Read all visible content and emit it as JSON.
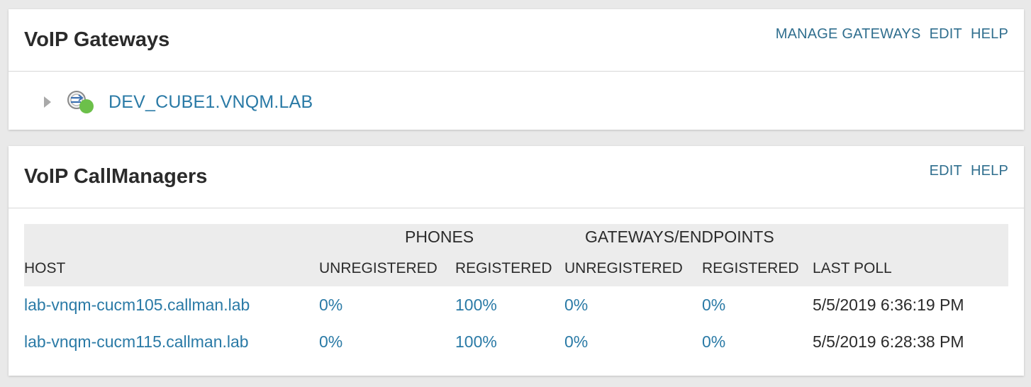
{
  "gateways_panel": {
    "title": "VoIP Gateways",
    "actions": [
      "MANAGE GATEWAYS",
      "EDIT",
      "HELP"
    ],
    "items": [
      {
        "name": "DEV_CUBE1.VNQM.LAB",
        "status": "up",
        "status_color": "#6cc04a"
      }
    ]
  },
  "callmanagers_panel": {
    "title": "VoIP CallManagers",
    "actions": [
      "EDIT",
      "HELP"
    ],
    "table": {
      "groups": {
        "phones": "PHONES",
        "gateways_endpoints": "GATEWAYS/ENDPOINTS"
      },
      "columns": [
        "HOST",
        "UNREGISTERED",
        "REGISTERED",
        "UNREGISTERED",
        "REGISTERED",
        "LAST POLL"
      ],
      "rows": [
        {
          "host": "lab-vnqm-cucm105.callman.lab",
          "phones_unregistered": "0%",
          "phones_registered": "100%",
          "gw_unregistered": "0%",
          "gw_registered": "0%",
          "last_poll": "5/5/2019 6:36:19 PM"
        },
        {
          "host": "lab-vnqm-cucm115.callman.lab",
          "phones_unregistered": "0%",
          "phones_registered": "100%",
          "gw_unregistered": "0%",
          "gw_registered": "0%",
          "last_poll": "5/5/2019 6:28:38 PM"
        }
      ]
    }
  },
  "colors": {
    "link": "#2a7aa6",
    "action_link": "#2f6e8e",
    "header_bg": "#ececec",
    "page_bg": "#e9e9e9"
  }
}
